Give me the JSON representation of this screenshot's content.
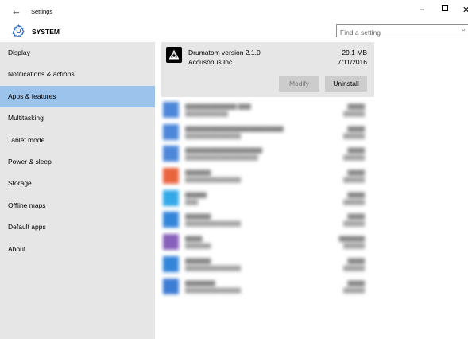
{
  "window": {
    "title": "Settings",
    "back_icon": "←",
    "minimize_icon": "–",
    "close_icon": "✕"
  },
  "header": {
    "title": "SYSTEM",
    "search_placeholder": "Find a setting",
    "search_icon": "⌕"
  },
  "sidebar": {
    "items": [
      {
        "label": "Display"
      },
      {
        "label": "Notifications & actions"
      },
      {
        "label": "Apps & features",
        "active": true
      },
      {
        "label": "Multitasking"
      },
      {
        "label": "Tablet mode"
      },
      {
        "label": "Power & sleep"
      },
      {
        "label": "Storage"
      },
      {
        "label": "Offline maps"
      },
      {
        "label": "Default apps"
      },
      {
        "label": "About"
      }
    ]
  },
  "selected_app": {
    "name": "Drumatom version 2.1.0",
    "publisher": "Accusonus Inc.",
    "size": "29.1 MB",
    "date": "7/11/2016",
    "modify_label": "Modify",
    "uninstall_label": "Uninstall"
  },
  "blurred_apps": [
    {
      "icon_color": "#3a7bd5"
    },
    {
      "icon_color": "#3a7bd5"
    },
    {
      "icon_color": "#3a7bd5"
    },
    {
      "icon_color": "#e8542a"
    },
    {
      "icon_color": "#1ea1e6"
    },
    {
      "icon_color": "#1e78d6"
    },
    {
      "icon_color": "#7b4fb3"
    },
    {
      "icon_color": "#1e78d6"
    },
    {
      "icon_color": "#2a6fd0"
    }
  ],
  "colors": {
    "accent": "#9cc3eb",
    "sidebar_bg": "#e6e6e6",
    "button_bg": "#cccccc"
  }
}
